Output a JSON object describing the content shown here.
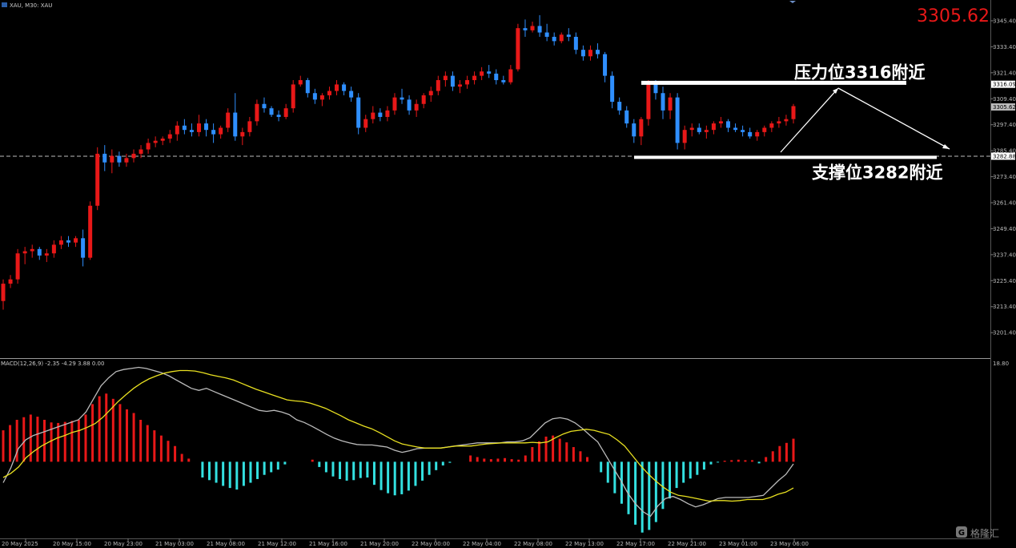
{
  "header": {
    "symbol_label": "XAU, M30: XAU"
  },
  "current_price_label": "3305.62",
  "macd_label": "MACD(12,26,9) -2.35 -4.29 3.88 0.00",
  "watermark": "格隆汇",
  "colors": {
    "up": "#e81818",
    "down": "#2f8fff",
    "hist_pos": "#e81818",
    "hist_neg": "#33e0e0",
    "signal": "#e8e020",
    "macd": "#bbbbbb",
    "annotation": "#ffffff"
  },
  "chart_data": [
    {
      "type": "candlestick",
      "title": "XAU, M30",
      "ylim": [
        3190,
        3355
      ],
      "y_ticks": [
        "3345.40",
        "3333.40",
        "3321.40",
        "3309.40",
        "3297.40",
        "3285.40",
        "3273.40",
        "3261.40",
        "3249.40",
        "3237.40",
        "3225.40",
        "3213.40",
        "3201.40"
      ],
      "x_ticks": [
        "20 May 2025",
        "20 May 15:00",
        "20 May 23:00",
        "21 May 03:00",
        "21 May 08:00",
        "21 May 12:00",
        "21 May 16:00",
        "21 May 20:00",
        "22 May 00:00",
        "22 May 04:00",
        "22 May 08:00",
        "22 May 13:00",
        "22 May 17:00",
        "22 May 21:00",
        "23 May 01:00",
        "23 May 06:00"
      ],
      "price_tags": [
        "3316.09",
        "3305.62",
        "3282.88"
      ],
      "ohlc": [
        [
          3216,
          3226,
          3212,
          3224
        ],
        [
          3224,
          3228,
          3222,
          3226
        ],
        [
          3226,
          3240,
          3224,
          3238
        ],
        [
          3238,
          3241,
          3233,
          3239
        ],
        [
          3239,
          3242,
          3236,
          3240
        ],
        [
          3240,
          3241,
          3235,
          3237
        ],
        [
          3237,
          3240,
          3234,
          3238
        ],
        [
          3238,
          3244,
          3236,
          3242
        ],
        [
          3242,
          3246,
          3240,
          3244
        ],
        [
          3244,
          3246,
          3241,
          3243
        ],
        [
          3243,
          3246,
          3241,
          3245
        ],
        [
          3245,
          3249,
          3232,
          3236
        ],
        [
          3236,
          3262,
          3235,
          3260
        ],
        [
          3260,
          3287,
          3258,
          3284
        ],
        [
          3284,
          3288,
          3276,
          3280
        ],
        [
          3280,
          3286,
          3275,
          3283
        ],
        [
          3283,
          3285,
          3278,
          3280
        ],
        [
          3280,
          3284,
          3278,
          3282
        ],
        [
          3282,
          3286,
          3280,
          3284
        ],
        [
          3284,
          3288,
          3282,
          3286
        ],
        [
          3286,
          3291,
          3284,
          3289
        ],
        [
          3289,
          3292,
          3287,
          3290
        ],
        [
          3290,
          3292,
          3288,
          3291
        ],
        [
          3291,
          3295,
          3289,
          3293
        ],
        [
          3293,
          3299,
          3290,
          3297
        ],
        [
          3297,
          3300,
          3293,
          3295
        ],
        [
          3295,
          3298,
          3292,
          3294
        ],
        [
          3294,
          3302,
          3292,
          3298
        ],
        [
          3298,
          3300,
          3292,
          3295
        ],
        [
          3295,
          3298,
          3289,
          3293
        ],
        [
          3293,
          3297,
          3291,
          3296
        ],
        [
          3296,
          3305,
          3294,
          3303
        ],
        [
          3303,
          3312,
          3290,
          3292
        ],
        [
          3292,
          3296,
          3288,
          3294
        ],
        [
          3294,
          3301,
          3292,
          3299
        ],
        [
          3299,
          3309,
          3297,
          3307
        ],
        [
          3307,
          3310,
          3303,
          3305
        ],
        [
          3305,
          3306,
          3301,
          3302
        ],
        [
          3302,
          3304,
          3299,
          3301
        ],
        [
          3301,
          3307,
          3300,
          3305
        ],
        [
          3305,
          3318,
          3303,
          3316
        ],
        [
          3316,
          3320,
          3315,
          3318
        ],
        [
          3318,
          3319,
          3310,
          3312
        ],
        [
          3312,
          3314,
          3307,
          3309
        ],
        [
          3309,
          3312,
          3306,
          3311
        ],
        [
          3311,
          3315,
          3309,
          3313
        ],
        [
          3313,
          3318,
          3311,
          3316
        ],
        [
          3316,
          3317,
          3311,
          3313
        ],
        [
          3313,
          3315,
          3308,
          3310
        ],
        [
          3310,
          3312,
          3293,
          3296
        ],
        [
          3296,
          3302,
          3294,
          3300
        ],
        [
          3300,
          3306,
          3298,
          3303
        ],
        [
          3303,
          3305,
          3299,
          3301
        ],
        [
          3301,
          3306,
          3299,
          3304
        ],
        [
          3304,
          3312,
          3302,
          3310
        ],
        [
          3310,
          3314,
          3307,
          3309
        ],
        [
          3309,
          3311,
          3302,
          3304
        ],
        [
          3304,
          3309,
          3301,
          3307
        ],
        [
          3307,
          3312,
          3305,
          3311
        ],
        [
          3311,
          3315,
          3308,
          3313
        ],
        [
          3313,
          3320,
          3311,
          3318
        ],
        [
          3318,
          3322,
          3315,
          3320
        ],
        [
          3320,
          3322,
          3313,
          3315
        ],
        [
          3315,
          3318,
          3312,
          3316
        ],
        [
          3316,
          3320,
          3314,
          3318
        ],
        [
          3318,
          3322,
          3316,
          3320
        ],
        [
          3320,
          3324,
          3318,
          3322
        ],
        [
          3322,
          3325,
          3319,
          3321
        ],
        [
          3321,
          3323,
          3316,
          3318
        ],
        [
          3318,
          3320,
          3316,
          3317
        ],
        [
          3317,
          3325,
          3316,
          3323
        ],
        [
          3323,
          3344,
          3322,
          3342
        ],
        [
          3342,
          3346,
          3338,
          3341
        ],
        [
          3341,
          3345,
          3340,
          3343
        ],
        [
          3343,
          3348,
          3338,
          3340
        ],
        [
          3340,
          3344,
          3336,
          3338
        ],
        [
          3338,
          3340,
          3334,
          3336
        ],
        [
          3336,
          3340,
          3335,
          3339
        ],
        [
          3339,
          3342,
          3336,
          3338
        ],
        [
          3338,
          3340,
          3330,
          3332
        ],
        [
          3332,
          3334,
          3327,
          3329
        ],
        [
          3329,
          3334,
          3327,
          3332
        ],
        [
          3332,
          3335,
          3328,
          3330
        ],
        [
          3330,
          3331,
          3317,
          3320
        ],
        [
          3320,
          3322,
          3305,
          3308
        ],
        [
          3308,
          3310,
          3302,
          3304
        ],
        [
          3304,
          3306,
          3296,
          3298
        ],
        [
          3298,
          3300,
          3289,
          3292
        ],
        [
          3292,
          3301,
          3288,
          3300
        ],
        [
          3300,
          3318,
          3297,
          3316
        ],
        [
          3316,
          3318,
          3309,
          3312
        ],
        [
          3312,
          3315,
          3300,
          3304
        ],
        [
          3304,
          3312,
          3300,
          3310
        ],
        [
          3310,
          3312,
          3286,
          3289
        ],
        [
          3289,
          3297,
          3286,
          3295
        ],
        [
          3295,
          3298,
          3292,
          3296
        ],
        [
          3296,
          3298,
          3293,
          3294
        ],
        [
          3294,
          3297,
          3291,
          3295
        ],
        [
          3295,
          3299,
          3293,
          3298
        ],
        [
          3298,
          3301,
          3296,
          3299
        ],
        [
          3299,
          3300,
          3294,
          3296
        ],
        [
          3296,
          3298,
          3294,
          3295
        ],
        [
          3295,
          3297,
          3292,
          3294
        ],
        [
          3294,
          3296,
          3291,
          3292
        ],
        [
          3292,
          3295,
          3290,
          3294
        ],
        [
          3294,
          3297,
          3292,
          3296
        ],
        [
          3296,
          3299,
          3294,
          3298
        ],
        [
          3298,
          3301,
          3296,
          3299
        ],
        [
          3299,
          3302,
          3297,
          3300
        ],
        [
          3300,
          3307,
          3298,
          3306
        ]
      ],
      "annotations": [
        {
          "text": "压力位3316附近",
          "level": 3316
        },
        {
          "text": "支撑位3282附近",
          "level": 3282
        }
      ]
    },
    {
      "type": "macd",
      "ylim": [
        -14,
        19
      ],
      "y_ticks": [
        "18.80"
      ],
      "histogram": [
        6,
        7,
        8,
        8.5,
        9,
        8.6,
        8,
        7.5,
        7.4,
        7.6,
        7.8,
        8,
        9,
        11,
        12.5,
        13,
        12,
        11,
        10,
        9.3,
        8,
        7,
        6,
        5,
        4,
        3,
        1.5,
        0.6,
        0,
        -3,
        -3.5,
        -4,
        -4.6,
        -5,
        -5.3,
        -4.6,
        -4,
        -3.3,
        -2.5,
        -2,
        -1.5,
        -0.5,
        0,
        0,
        0,
        0.4,
        -1,
        -2,
        -2.8,
        -3.3,
        -3.6,
        -3.5,
        -3.1,
        -3,
        -4.4,
        -5.4,
        -6,
        -6.4,
        -6.2,
        -5.5,
        -4.6,
        -3.6,
        -2.5,
        -1.6,
        -0.7,
        -0.2,
        0,
        0,
        1.2,
        0.9,
        0.6,
        0.5,
        0.6,
        0.7,
        0.5,
        0.4,
        1.2,
        2.8,
        3.9,
        4.8,
        5,
        4.4,
        3.7,
        2.8,
        2,
        0.9,
        0,
        -2,
        -4,
        -6,
        -8,
        -10,
        -12,
        -13.5,
        -13,
        -11.5,
        -9,
        -7,
        -5,
        -4,
        -3.2,
        -2.5,
        -1.5,
        -0.5,
        -0.1,
        0.2,
        0.3,
        0.4,
        0.3,
        0.3,
        -0.3,
        0.9,
        2,
        3,
        3.6,
        4.4
      ],
      "macd_line": [
        -4,
        -1.2,
        2.5,
        4.2,
        5,
        5.5,
        6,
        6.5,
        7,
        7.5,
        8,
        9.5,
        12,
        14.5,
        16,
        17.2,
        17.6,
        17.8,
        18,
        17.8,
        17.4,
        17,
        16.4,
        15.6,
        14.8,
        14,
        13.6,
        14,
        13.4,
        12.8,
        12.2,
        11.6,
        11,
        10.4,
        9.8,
        9.6,
        9.8,
        9.5,
        9,
        8,
        7.5,
        6.8,
        6,
        5.2,
        4.5,
        4,
        3.6,
        3.3,
        3.2,
        3.2,
        3,
        2.8,
        2.2,
        1.8,
        2.1,
        2.5,
        2.6,
        2.6,
        2.6,
        2.8,
        3,
        3.2,
        3.4,
        3.6,
        3.6,
        3.6,
        3.6,
        3.8,
        3.8,
        4,
        4.6,
        6,
        7.4,
        8.2,
        8.4,
        8.1,
        7.4,
        6.3,
        5,
        3.8,
        1.4,
        -1,
        -3.4,
        -6,
        -8,
        -9.5,
        -10.4,
        -8.4,
        -7,
        -6.6,
        -7.2,
        -8,
        -8.6,
        -8.2,
        -7.6,
        -7,
        -6.8,
        -6.8,
        -6.8,
        -6.8,
        -6.6,
        -6.4,
        -5,
        -3.6,
        -2.4,
        -0.4
      ],
      "signal_line": [
        -3,
        -2.2,
        -1,
        0.8,
        2,
        3,
        3.8,
        4.5,
        5,
        5.6,
        6,
        6.6,
        7.3,
        8.5,
        10,
        11.5,
        12.8,
        14,
        15,
        15.8,
        16.4,
        16.9,
        17.2,
        17.4,
        17.4,
        17.3,
        17,
        16.6,
        16.3,
        16,
        15.6,
        15,
        14.4,
        13.8,
        13.3,
        12.8,
        12.3,
        11.8,
        11.6,
        11.5,
        11.2,
        10.7,
        10.2,
        9.5,
        8.8,
        8,
        7.4,
        6.8,
        6.3,
        5.6,
        4.8,
        4,
        3.4,
        3.1,
        2.8,
        2.6,
        2.6,
        2.6,
        2.8,
        3,
        3,
        3,
        3.2,
        3.4,
        3.5,
        3.6,
        3.6,
        3.6,
        3.6,
        3.7,
        3.6,
        3.8,
        4.6,
        5.3,
        5.8,
        6,
        6.2,
        6,
        5.6,
        5.2,
        4.2,
        3,
        1.2,
        -0.6,
        -2.2,
        -3.6,
        -4.8,
        -5.8,
        -6.4,
        -6.6,
        -6.9,
        -7.2,
        -7.5,
        -7.4,
        -7.4,
        -7.5,
        -7.4,
        -7.2,
        -7.2,
        -7.2,
        -6.8,
        -6.2,
        -5.8,
        -5
      ]
    }
  ]
}
